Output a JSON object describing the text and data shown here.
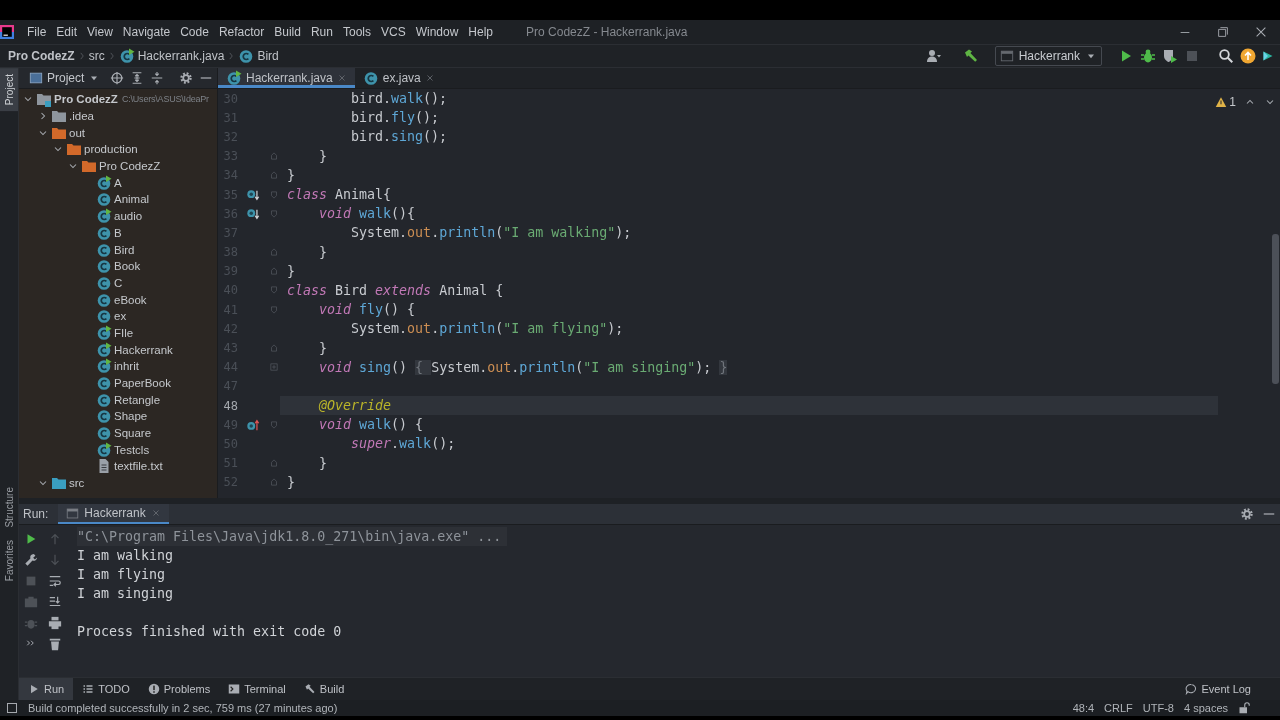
{
  "window": {
    "title": "Pro CodezZ - Hackerrank.java"
  },
  "menu": [
    "File",
    "Edit",
    "View",
    "Navigate",
    "Code",
    "Refactor",
    "Build",
    "Run",
    "Tools",
    "VCS",
    "Window",
    "Help"
  ],
  "breadcrumbs": [
    {
      "label": "Pro CodezZ",
      "kind": "project"
    },
    {
      "label": "src",
      "kind": "folder"
    },
    {
      "label": "Hackerrank.java",
      "kind": "java-file"
    },
    {
      "label": "Bird",
      "kind": "class"
    }
  ],
  "toolbar": {
    "run_configuration": "Hackerrank"
  },
  "tool_stripe": [
    {
      "label": "Project",
      "selected": true
    },
    {
      "label": "Structure",
      "selected": false
    },
    {
      "label": "Favorites",
      "selected": false
    }
  ],
  "project_panel": {
    "title": "Project",
    "tree": [
      {
        "label": "Pro CodezZ",
        "path": "C:\\Users\\ASUS\\IdeaPr",
        "kind": "module",
        "expanded": true,
        "children": [
          {
            "label": ".idea",
            "kind": "folder",
            "expanded": false
          },
          {
            "label": "out",
            "kind": "excluded-folder",
            "expanded": true,
            "children": [
              {
                "label": "production",
                "kind": "excluded-folder",
                "expanded": true,
                "children": [
                  {
                    "label": "Pro CodezZ",
                    "kind": "excluded-folder",
                    "expanded": true,
                    "children": [
                      {
                        "label": "A",
                        "kind": "main-class"
                      },
                      {
                        "label": "Animal",
                        "kind": "class"
                      },
                      {
                        "label": "audio",
                        "kind": "main-class"
                      },
                      {
                        "label": "B",
                        "kind": "class"
                      },
                      {
                        "label": "Bird",
                        "kind": "class"
                      },
                      {
                        "label": "Book",
                        "kind": "class"
                      },
                      {
                        "label": "C",
                        "kind": "class"
                      },
                      {
                        "label": "eBook",
                        "kind": "class"
                      },
                      {
                        "label": "ex",
                        "kind": "class"
                      },
                      {
                        "label": "FIle",
                        "kind": "main-class"
                      },
                      {
                        "label": "Hackerrank",
                        "kind": "main-class"
                      },
                      {
                        "label": "inhrit",
                        "kind": "main-class"
                      },
                      {
                        "label": "PaperBook",
                        "kind": "class"
                      },
                      {
                        "label": "Retangle",
                        "kind": "class"
                      },
                      {
                        "label": "Shape",
                        "kind": "class"
                      },
                      {
                        "label": "Square",
                        "kind": "class"
                      },
                      {
                        "label": "Testcls",
                        "kind": "main-class"
                      },
                      {
                        "label": "textfile.txt",
                        "kind": "text-file"
                      }
                    ]
                  }
                ]
              }
            ]
          },
          {
            "label": "src",
            "kind": "source-folder",
            "expanded": true
          }
        ]
      }
    ]
  },
  "editor": {
    "tabs": [
      {
        "label": "Hackerrank.java",
        "kind": "java-file",
        "selected": true
      },
      {
        "label": "ex.java",
        "kind": "class",
        "selected": false
      }
    ],
    "warnings": "1",
    "lines": [
      {
        "number": "30",
        "current": false,
        "fold_start": false,
        "fold_end": false,
        "folded": false,
        "overridden": false,
        "overriding": false,
        "tokens": [
          {
            "text": "        bird.",
            "kind": "plain"
          },
          {
            "text": "walk",
            "kind": "method"
          },
          {
            "text": "();",
            "kind": "plain"
          }
        ]
      },
      {
        "number": "31",
        "current": false,
        "fold_start": false,
        "fold_end": false,
        "folded": false,
        "overridden": false,
        "overriding": false,
        "tokens": [
          {
            "text": "        bird.",
            "kind": "plain"
          },
          {
            "text": "fly",
            "kind": "method"
          },
          {
            "text": "();",
            "kind": "plain"
          }
        ]
      },
      {
        "number": "32",
        "current": false,
        "fold_start": false,
        "fold_end": false,
        "folded": false,
        "overridden": false,
        "overriding": false,
        "tokens": [
          {
            "text": "        bird.",
            "kind": "plain"
          },
          {
            "text": "sing",
            "kind": "method"
          },
          {
            "text": "();",
            "kind": "plain"
          }
        ]
      },
      {
        "number": "33",
        "current": false,
        "fold_start": false,
        "fold_end": true,
        "folded": false,
        "overridden": false,
        "overriding": false,
        "tokens": [
          {
            "text": "    }",
            "kind": "plain"
          }
        ]
      },
      {
        "number": "34",
        "current": false,
        "fold_start": false,
        "fold_end": true,
        "folded": false,
        "overridden": false,
        "overriding": false,
        "tokens": [
          {
            "text": "}",
            "kind": "plain"
          }
        ]
      },
      {
        "number": "35",
        "current": false,
        "fold_start": true,
        "fold_end": false,
        "folded": false,
        "overridden": true,
        "overriding": false,
        "tokens": [
          {
            "text": "class",
            "kind": "keyword"
          },
          {
            "text": " Animal{",
            "kind": "plain"
          }
        ]
      },
      {
        "number": "36",
        "current": false,
        "fold_start": true,
        "fold_end": false,
        "folded": false,
        "overridden": true,
        "overriding": false,
        "tokens": [
          {
            "text": "    void",
            "kind": "keyword"
          },
          {
            "text": " walk",
            "kind": "method"
          },
          {
            "text": "(){",
            "kind": "plain"
          }
        ]
      },
      {
        "number": "37",
        "current": false,
        "fold_start": false,
        "fold_end": false,
        "folded": false,
        "overridden": false,
        "overriding": false,
        "tokens": [
          {
            "text": "        System.",
            "kind": "plain"
          },
          {
            "text": "out",
            "kind": "field"
          },
          {
            "text": ".",
            "kind": "plain"
          },
          {
            "text": "println",
            "kind": "method"
          },
          {
            "text": "(",
            "kind": "plain"
          },
          {
            "text": "\"I am walking\"",
            "kind": "string"
          },
          {
            "text": ");",
            "kind": "plain"
          }
        ]
      },
      {
        "number": "38",
        "current": false,
        "fold_start": false,
        "fold_end": true,
        "folded": false,
        "overridden": false,
        "overriding": false,
        "tokens": [
          {
            "text": "    }",
            "kind": "plain"
          }
        ]
      },
      {
        "number": "39",
        "current": false,
        "fold_start": false,
        "fold_end": true,
        "folded": false,
        "overridden": false,
        "overriding": false,
        "tokens": [
          {
            "text": "}",
            "kind": "plain"
          }
        ]
      },
      {
        "number": "40",
        "current": false,
        "fold_start": true,
        "fold_end": false,
        "folded": false,
        "overridden": false,
        "overriding": false,
        "tokens": [
          {
            "text": "class",
            "kind": "keyword"
          },
          {
            "text": " Bird ",
            "kind": "plain"
          },
          {
            "text": "extends",
            "kind": "keyword"
          },
          {
            "text": " Animal {",
            "kind": "plain"
          }
        ]
      },
      {
        "number": "41",
        "current": false,
        "fold_start": true,
        "fold_end": false,
        "folded": false,
        "overridden": false,
        "overriding": false,
        "tokens": [
          {
            "text": "    void",
            "kind": "keyword"
          },
          {
            "text": " fly",
            "kind": "method"
          },
          {
            "text": "() {",
            "kind": "plain"
          }
        ]
      },
      {
        "number": "42",
        "current": false,
        "fold_start": false,
        "fold_end": false,
        "folded": false,
        "overridden": false,
        "overriding": false,
        "tokens": [
          {
            "text": "        System.",
            "kind": "plain"
          },
          {
            "text": "out",
            "kind": "field"
          },
          {
            "text": ".",
            "kind": "plain"
          },
          {
            "text": "println",
            "kind": "method"
          },
          {
            "text": "(",
            "kind": "plain"
          },
          {
            "text": "\"I am flying\"",
            "kind": "string"
          },
          {
            "text": ");",
            "kind": "plain"
          }
        ]
      },
      {
        "number": "43",
        "current": false,
        "fold_start": false,
        "fold_end": true,
        "folded": false,
        "overridden": false,
        "overriding": false,
        "tokens": [
          {
            "text": "    }",
            "kind": "plain"
          }
        ]
      },
      {
        "number": "44",
        "current": false,
        "fold_start": false,
        "fold_end": false,
        "folded": true,
        "overridden": false,
        "overriding": false,
        "tokens": [
          {
            "text": "    void",
            "kind": "keyword"
          },
          {
            "text": " sing",
            "kind": "method"
          },
          {
            "text": "() ",
            "kind": "plain"
          },
          {
            "text": "{ ",
            "kind": "folded"
          },
          {
            "text": "System.",
            "kind": "plain"
          },
          {
            "text": "out",
            "kind": "field"
          },
          {
            "text": ".",
            "kind": "plain"
          },
          {
            "text": "println",
            "kind": "method"
          },
          {
            "text": "(",
            "kind": "plain"
          },
          {
            "text": "\"I am singing\"",
            "kind": "string"
          },
          {
            "text": "); ",
            "kind": "plain"
          },
          {
            "text": "}",
            "kind": "folded"
          }
        ]
      },
      {
        "number": "47",
        "current": false,
        "fold_start": false,
        "fold_end": false,
        "folded": false,
        "overridden": false,
        "overriding": false
      },
      {
        "number": "48",
        "current": true,
        "fold_start": false,
        "fold_end": false,
        "folded": false,
        "overridden": false,
        "overriding": false,
        "tokens": [
          {
            "text": "    @Override",
            "kind": "annotation"
          }
        ]
      },
      {
        "number": "49",
        "current": false,
        "fold_start": true,
        "fold_end": false,
        "folded": false,
        "overridden": false,
        "overriding": true,
        "tokens": [
          {
            "text": "    void",
            "kind": "keyword"
          },
          {
            "text": " walk",
            "kind": "method"
          },
          {
            "text": "() {",
            "kind": "plain"
          }
        ]
      },
      {
        "number": "50",
        "current": false,
        "fold_start": false,
        "fold_end": false,
        "folded": false,
        "overridden": false,
        "overriding": false,
        "tokens": [
          {
            "text": "        super",
            "kind": "keyword"
          },
          {
            "text": ".",
            "kind": "plain"
          },
          {
            "text": "walk",
            "kind": "method"
          },
          {
            "text": "();",
            "kind": "plain"
          }
        ]
      },
      {
        "number": "51",
        "current": false,
        "fold_start": false,
        "fold_end": true,
        "folded": false,
        "overridden": false,
        "overriding": false,
        "tokens": [
          {
            "text": "    }",
            "kind": "plain"
          }
        ]
      },
      {
        "number": "52",
        "current": false,
        "fold_start": false,
        "fold_end": true,
        "folded": false,
        "overridden": false,
        "overriding": false,
        "tokens": [
          {
            "text": "}",
            "kind": "plain"
          }
        ]
      }
    ]
  },
  "run_panel": {
    "label": "Run:",
    "tabs": [
      {
        "label": "Hackerrank",
        "selected": true
      }
    ],
    "output": [
      {
        "text": "\"C:\\Program Files\\Java\\jdk1.8.0_271\\bin\\java.exe\" ...",
        "kind": "command"
      },
      {
        "text": "I am walking",
        "kind": "output"
      },
      {
        "text": "I am flying",
        "kind": "output"
      },
      {
        "text": "I am singing",
        "kind": "output"
      },
      {
        "text": "Process finished with exit code 0",
        "kind": "exit"
      }
    ]
  },
  "bottom_tabs": [
    {
      "label": "Run",
      "kind": "run",
      "selected": true
    },
    {
      "label": "TODO",
      "kind": "todo",
      "selected": false
    },
    {
      "label": "Problems",
      "kind": "problems",
      "selected": false
    },
    {
      "label": "Terminal",
      "kind": "terminal",
      "selected": false
    },
    {
      "label": "Build",
      "kind": "build",
      "selected": false
    }
  ],
  "event_log": "Event Log",
  "status_bar": {
    "message": "Build completed successfully in 2 sec, 759 ms (27 minutes ago)",
    "position": "48:4",
    "line_separator": "CRLF",
    "encoding": "UTF-8",
    "indent": "4 spaces"
  }
}
